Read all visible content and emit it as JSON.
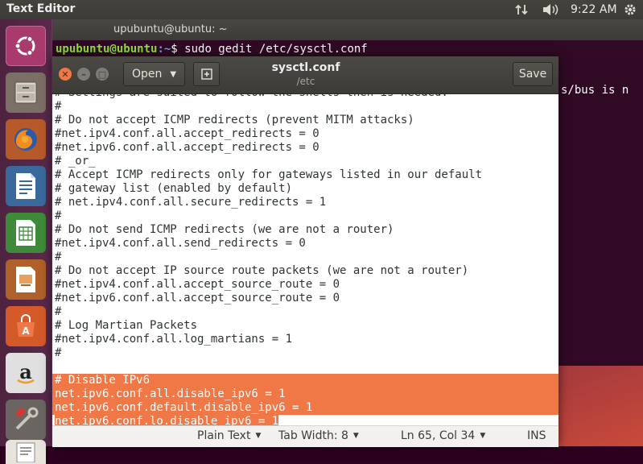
{
  "top_panel": {
    "app_title": "Text Editor",
    "clock": "9:22 AM",
    "icons": [
      "network-updown-icon",
      "volume-icon",
      "gear-icon"
    ]
  },
  "launcher": {
    "items": [
      "ubuntu-dash-icon",
      "files-icon",
      "firefox-icon",
      "libreoffice-writer-icon",
      "libreoffice-calc-icon",
      "libreoffice-impress-icon",
      "software-center-icon",
      "amazon-icon",
      "system-settings-icon",
      "text-editor-icon"
    ]
  },
  "terminal": {
    "title": "upubuntu@ubuntu: ~",
    "prompt_user": "upubuntu@ubuntu",
    "prompt_path": ":~",
    "prompt_symbol": "$ ",
    "command": "sudo gedit /etc/sysctl.conf",
    "partial_text": "s/bus is n"
  },
  "gedit": {
    "open_label": "Open",
    "save_label": "Save",
    "doc_title": "sysctl.conf",
    "doc_path": "/etc",
    "lines": [
      "#",
      "# Do not accept ICMP redirects (prevent MITM attacks)",
      "#net.ipv4.conf.all.accept_redirects = 0",
      "#net.ipv6.conf.all.accept_redirects = 0",
      "# _or_",
      "# Accept ICMP redirects only for gateways listed in our default",
      "# gateway list (enabled by default)",
      "# net.ipv4.conf.all.secure_redirects = 1",
      "#",
      "# Do not send ICMP redirects (we are not a router)",
      "#net.ipv4.conf.all.send_redirects = 0",
      "#",
      "# Do not accept IP source route packets (we are not a router)",
      "#net.ipv4.conf.all.accept_source_route = 0",
      "#net.ipv6.conf.all.accept_source_route = 0",
      "#",
      "# Log Martian Packets",
      "#net.ipv4.conf.all.log_martians = 1",
      "#",
      "",
      "# Disable IPv6",
      "net.ipv6.conf.all.disable_ipv6 = 1",
      "net.ipv6.conf.default.disable_ipv6 = 1",
      "net.ipv6.conf.lo.disable_ipv6 = 1"
    ],
    "status": {
      "language": "Plain Text",
      "tab_width": "Tab Width: 8",
      "position": "Ln 65, Col 34",
      "mode": "INS"
    },
    "selection_color": "#f07746"
  }
}
